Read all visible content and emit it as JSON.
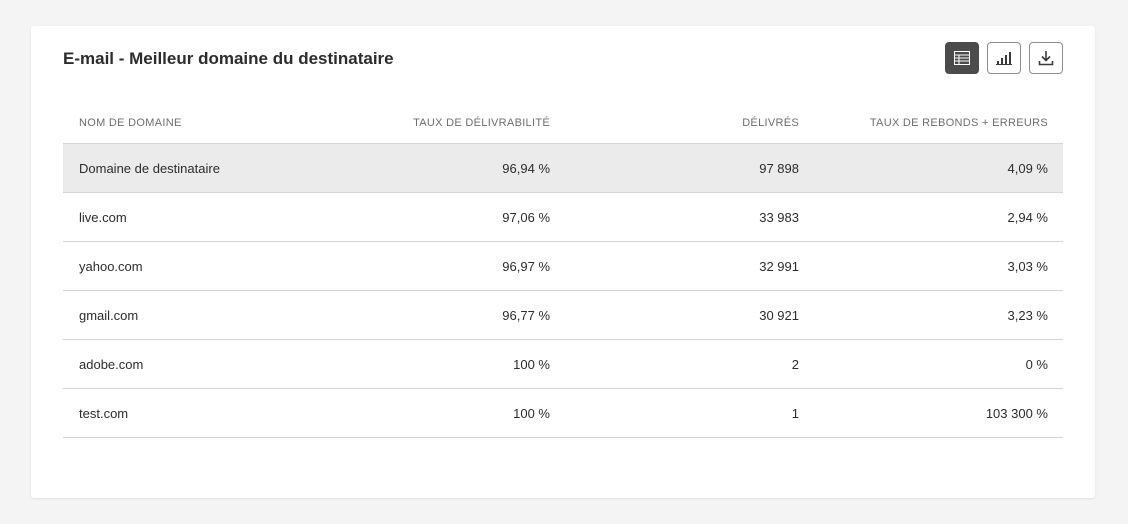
{
  "widget": {
    "title": "E-mail - Meilleur domaine du destinataire",
    "toolbar": {
      "table_view_icon": "table-icon",
      "chart_view_icon": "bar-chart-icon",
      "download_icon": "download-icon"
    }
  },
  "table": {
    "headers": [
      "NOM DE DOMAINE",
      "TAUX DE DÉLIVRABILITÉ",
      "DÉLIVRÉS",
      "TAUX DE REBONDS + ERREURS"
    ],
    "rows": [
      [
        "Domaine de destinataire",
        "96,94 %",
        "97 898",
        "4,09 %"
      ],
      [
        "live.com",
        "97,06 %",
        "33 983",
        "2,94 %"
      ],
      [
        "yahoo.com",
        "96,97 %",
        "32 991",
        "3,03 %"
      ],
      [
        "gmail.com",
        "96,77 %",
        "30 921",
        "3,23 %"
      ],
      [
        "adobe.com",
        "100 %",
        "2",
        "0 %"
      ],
      [
        "test.com",
        "100 %",
        "1",
        "103 300 %"
      ]
    ]
  },
  "colors": {
    "page_background": "#f4f4f4",
    "card_background": "#ffffff",
    "active_button": "#4b4b4b",
    "summary_row": "#ebebeb"
  }
}
